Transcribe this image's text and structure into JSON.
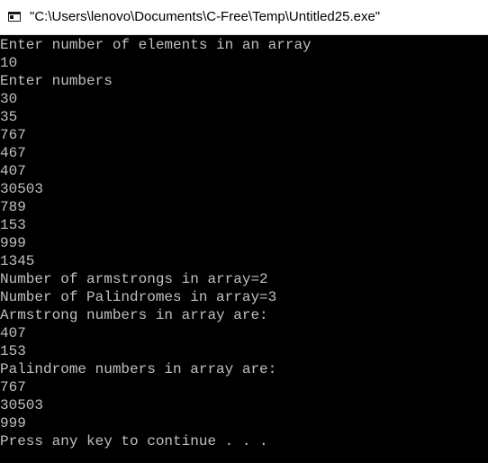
{
  "window": {
    "title": "\"C:\\Users\\lenovo\\Documents\\C-Free\\Temp\\Untitled25.exe\"",
    "icon": "console-window-icon"
  },
  "colors": {
    "console_background": "#000000",
    "console_text": "#c0c0c0",
    "titlebar_background": "#ffffff"
  },
  "console": {
    "lines": [
      "Enter number of elements in an array",
      "10",
      "Enter numbers",
      "30",
      "35",
      "767",
      "467",
      "407",
      "30503",
      "789",
      "153",
      "999",
      "1345",
      "Number of armstrongs in array=2",
      "Number of Palindromes in array=3",
      "Armstrong numbers in array are:",
      "407",
      "153",
      "Palindrome numbers in array are:",
      "767",
      "30503",
      "999",
      "Press any key to continue . . ."
    ]
  }
}
